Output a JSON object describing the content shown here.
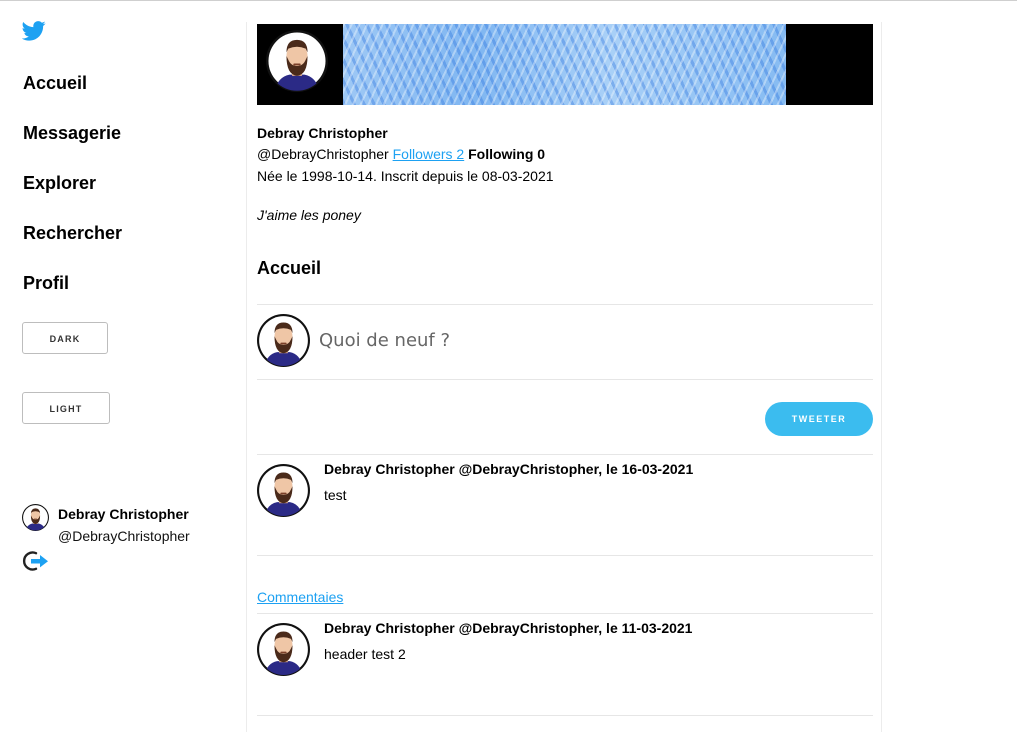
{
  "colors": {
    "accent": "#1da1f2",
    "tweet_button": "#3bbcef",
    "avatar_shirt": "#2a2a8a"
  },
  "sidebar": {
    "logo_icon": "twitter-bird-icon",
    "nav": [
      {
        "label": "Accueil"
      },
      {
        "label": "Messagerie"
      },
      {
        "label": "Explorer"
      },
      {
        "label": "Rechercher"
      },
      {
        "label": "Profil"
      }
    ],
    "dark_label": "DARK",
    "light_label": "LIGHT",
    "user": {
      "name": "Debray Christopher",
      "handle": "@DebrayChristopher"
    },
    "logout_icon": "logout-icon"
  },
  "profile": {
    "name": "Debray Christopher",
    "handle": "@DebrayChristopher",
    "followers_label": "Followers 2",
    "following_label": "Following 0",
    "details": "Née le 1998-10-14. Inscrit depuis le 08-03-2021",
    "bio": "J'aime les poney"
  },
  "feed": {
    "title": "Accueil",
    "compose_placeholder": "Quoi de neuf ?",
    "tweet_button": "TWEETER",
    "comments_label": "Commentaies",
    "tweets": [
      {
        "header": "Debray Christopher @DebrayChristopher, le 16-03-2021",
        "text": "test"
      },
      {
        "header": "Debray Christopher @DebrayChristopher, le 11-03-2021",
        "text": "header test 2"
      }
    ]
  }
}
